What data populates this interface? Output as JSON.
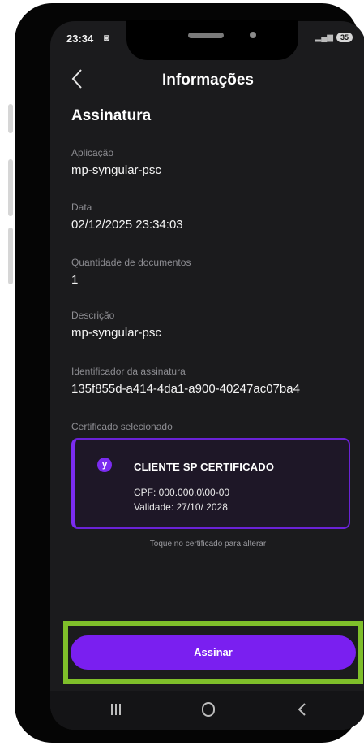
{
  "status_bar": {
    "time": "23:34",
    "battery": "35"
  },
  "header": {
    "title": "Informações"
  },
  "section": {
    "title": "Assinatura"
  },
  "fields": [
    {
      "label": "Aplicação",
      "value": "mp-syngular-psc"
    },
    {
      "label": "Data",
      "value": "02/12/2025 23:34:03"
    },
    {
      "label": "Quantidade de documentos",
      "value": "1"
    },
    {
      "label": "Descrição",
      "value": "mp-syngular-psc"
    },
    {
      "label": "Identificador da assinatura",
      "value": "135f855d-a414-4da1-a900-40247ac07ba4"
    }
  ],
  "certificate": {
    "section_label": "Certificado selecionado",
    "badge": "y",
    "name": "CLIENTE SP CERTIFICADO",
    "cpf": "CPF: 000.000.0\\00-00",
    "validity": "Validade: 27/10/ 2028",
    "hint": "Toque no certificado para alterar"
  },
  "actions": {
    "sign_label": "Assinar"
  },
  "colors": {
    "accent": "#7a1ff0",
    "background": "#1b1b1d",
    "highlight": "#7fbf2a"
  },
  "icons": [
    "back-icon",
    "recents-icon",
    "home-icon",
    "back-nav-icon"
  ]
}
